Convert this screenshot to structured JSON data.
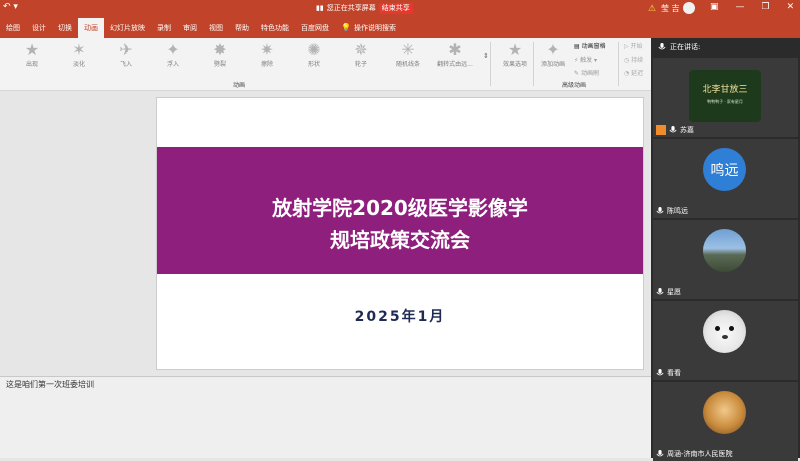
{
  "titlebar": {
    "sharing_text": "您正在共享屏幕",
    "end_share_label": "结束共享",
    "user_name": "莹 吉"
  },
  "tabs": [
    "绘图",
    "设计",
    "切换",
    "动画",
    "幻灯片放映",
    "录制",
    "审阅",
    "视图",
    "帮助",
    "特色功能",
    "百度网盘"
  ],
  "active_tab": "动画",
  "search_hint": "操作说明搜索",
  "ribbon": {
    "animations": [
      "出现",
      "淡化",
      "飞入",
      "浮入",
      "劈裂",
      "擦除",
      "形状",
      "轮子",
      "随机线条",
      "翻转式由远..."
    ],
    "effect_options": "效果选项",
    "add_animation": "添加动画",
    "animation_pane": "动画窗格",
    "trigger": "触发",
    "animation_painter": "动画刷",
    "group_animation": "动画",
    "group_advanced": "高级动画",
    "timing": [
      "开始",
      "持续",
      "延迟"
    ]
  },
  "slide": {
    "title_line1": "放射学院2020级医学影像学",
    "title_line2": "规培政策交流会",
    "date": "2025年1月",
    "band_color": "#8e1f7c"
  },
  "notes": "这是咱们第一次班委培训",
  "side_panel": {
    "speaking_label": "正在讲话:",
    "participants": [
      {
        "name": "苏嘉",
        "avatar_text": "北李甘放三",
        "avatar_sub": "鸭鸭鸭子 · 家有星月"
      },
      {
        "name": "陈鸣远",
        "avatar_text": "鸣远"
      },
      {
        "name": "星愿",
        "avatar_text": ""
      },
      {
        "name": "看看",
        "avatar_text": ""
      },
      {
        "name": "周涵-济南市人民医院",
        "avatar_text": ""
      }
    ]
  }
}
